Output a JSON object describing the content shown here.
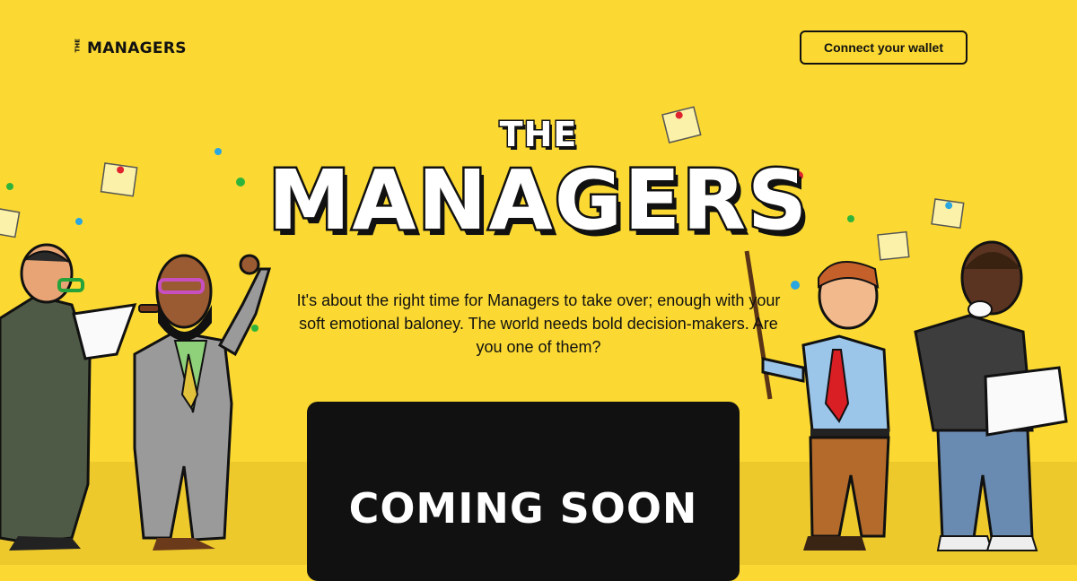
{
  "header": {
    "logo_small": "THE",
    "logo_main": "MANAGERS",
    "wallet_button": "Connect your wallet"
  },
  "hero": {
    "title_small": "THE",
    "title_main": "MANAGERS",
    "tagline": "It's about the right time for Managers to take over; enough with your soft emotional baloney. The world needs bold decision-makers. Are you one of them?",
    "coming_soon": "COMING SOON"
  },
  "icons": [
    "sticky-note-icon",
    "push-pin-icon",
    "confetti-dot-icon"
  ],
  "colors": {
    "background": "#fbd932",
    "floor": "#edc92c",
    "ink": "#111111",
    "card": "#111111",
    "note": "#fbf1a8"
  }
}
